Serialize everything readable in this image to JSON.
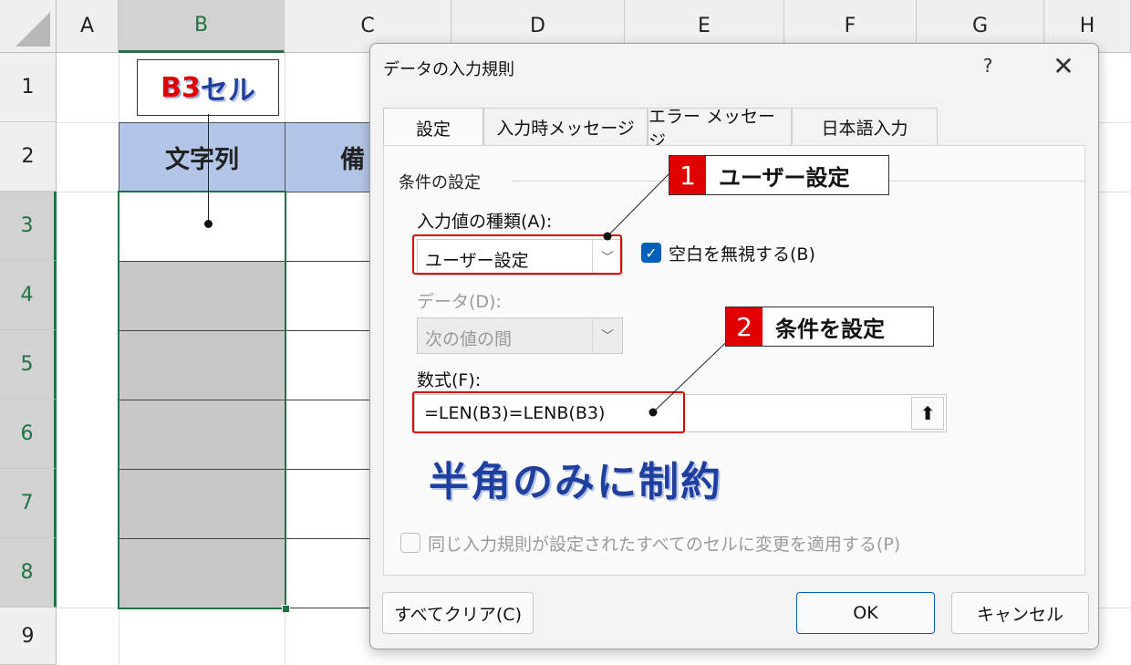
{
  "sheet": {
    "columns": [
      "A",
      "B",
      "C",
      "D",
      "E",
      "F",
      "G",
      "H"
    ],
    "rows": [
      "1",
      "2",
      "3",
      "4",
      "5",
      "6",
      "7",
      "8",
      "9"
    ],
    "selected_column": "B",
    "table_header_b": "文字列",
    "table_header_c": "備",
    "callout_b3_part1": "B3",
    "callout_b3_part2": "セル"
  },
  "dialog": {
    "title": "データの入力規則",
    "help": "?",
    "close": "✕",
    "tabs": [
      "設定",
      "入力時メッセージ",
      "エラー メッセージ",
      "日本語入力"
    ],
    "active_tab": "設定",
    "group_label": "条件の設定",
    "allow_label": "入力値の種類(A):",
    "allow_value": "ユーザー設定",
    "ignore_blank_label": "空白を無視する(B)",
    "ignore_blank_checked": true,
    "data_label": "データ(D):",
    "data_value": "次の値の間",
    "formula_label": "数式(F):",
    "formula_value": "=LEN(B3)=LENB(B3)",
    "apply_all_label": "同じ入力規則が設定されたすべてのセルに変更を適用する(P)",
    "apply_all_checked": false,
    "clear_all_button": "すべてクリア(C)",
    "ok_button": "OK",
    "cancel_button": "キャンセル"
  },
  "annotations": {
    "step1_number": "1",
    "step1_text": "ユーザー設定",
    "step2_number": "2",
    "step2_text": "条件を設定",
    "note": "半角のみに制約"
  },
  "colors": {
    "accent_blue": "#005fb8",
    "excel_green": "#217346",
    "annotation_red": "#e00000",
    "header_fill": "#b4c6e7"
  }
}
